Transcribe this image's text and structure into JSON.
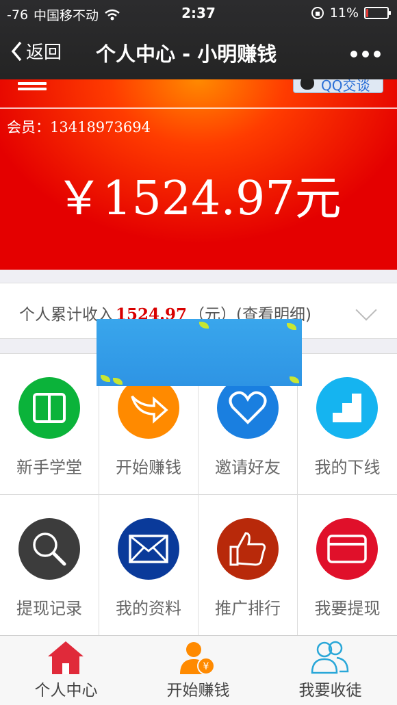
{
  "status_bar": {
    "signal": "-76",
    "carrier": "中国移不动",
    "time": "2:37",
    "battery": "11%",
    "battery_level": 0.11
  },
  "navbar": {
    "back_label": "返回",
    "title": "个人中心 - 小明赚钱"
  },
  "hero": {
    "qq_button": "QQ交谈",
    "member_label": "会员：",
    "member_id": "13418973694",
    "balance": "￥1524.97元"
  },
  "income": {
    "prefix": "个人累计收入",
    "amount": "1524.97",
    "unit": "（元）",
    "detail_link": "(查看明细)"
  },
  "grid": [
    {
      "label": "新手学堂",
      "icon": "book-icon",
      "color": "#0bb33a"
    },
    {
      "label": "开始赚钱",
      "icon": "arrow-icon",
      "color": "#ff8a00"
    },
    {
      "label": "邀请好友",
      "icon": "heart-icon",
      "color": "#1a7fe0"
    },
    {
      "label": "我的下线",
      "icon": "stairs-icon",
      "color": "#15b4f0"
    },
    {
      "label": "提现记录",
      "icon": "search-icon",
      "color": "#3c3c3c"
    },
    {
      "label": "我的资料",
      "icon": "mail-icon",
      "color": "#0a3a9a"
    },
    {
      "label": "推广排行",
      "icon": "thumbs-up-icon",
      "color": "#b8290a"
    },
    {
      "label": "我要提现",
      "icon": "card-icon",
      "color": "#e0102a"
    }
  ],
  "tabs": [
    {
      "label": "个人中心",
      "icon": "home-icon"
    },
    {
      "label": "开始赚钱",
      "icon": "user-money-icon"
    },
    {
      "label": "我要收徒",
      "icon": "users-icon"
    }
  ]
}
